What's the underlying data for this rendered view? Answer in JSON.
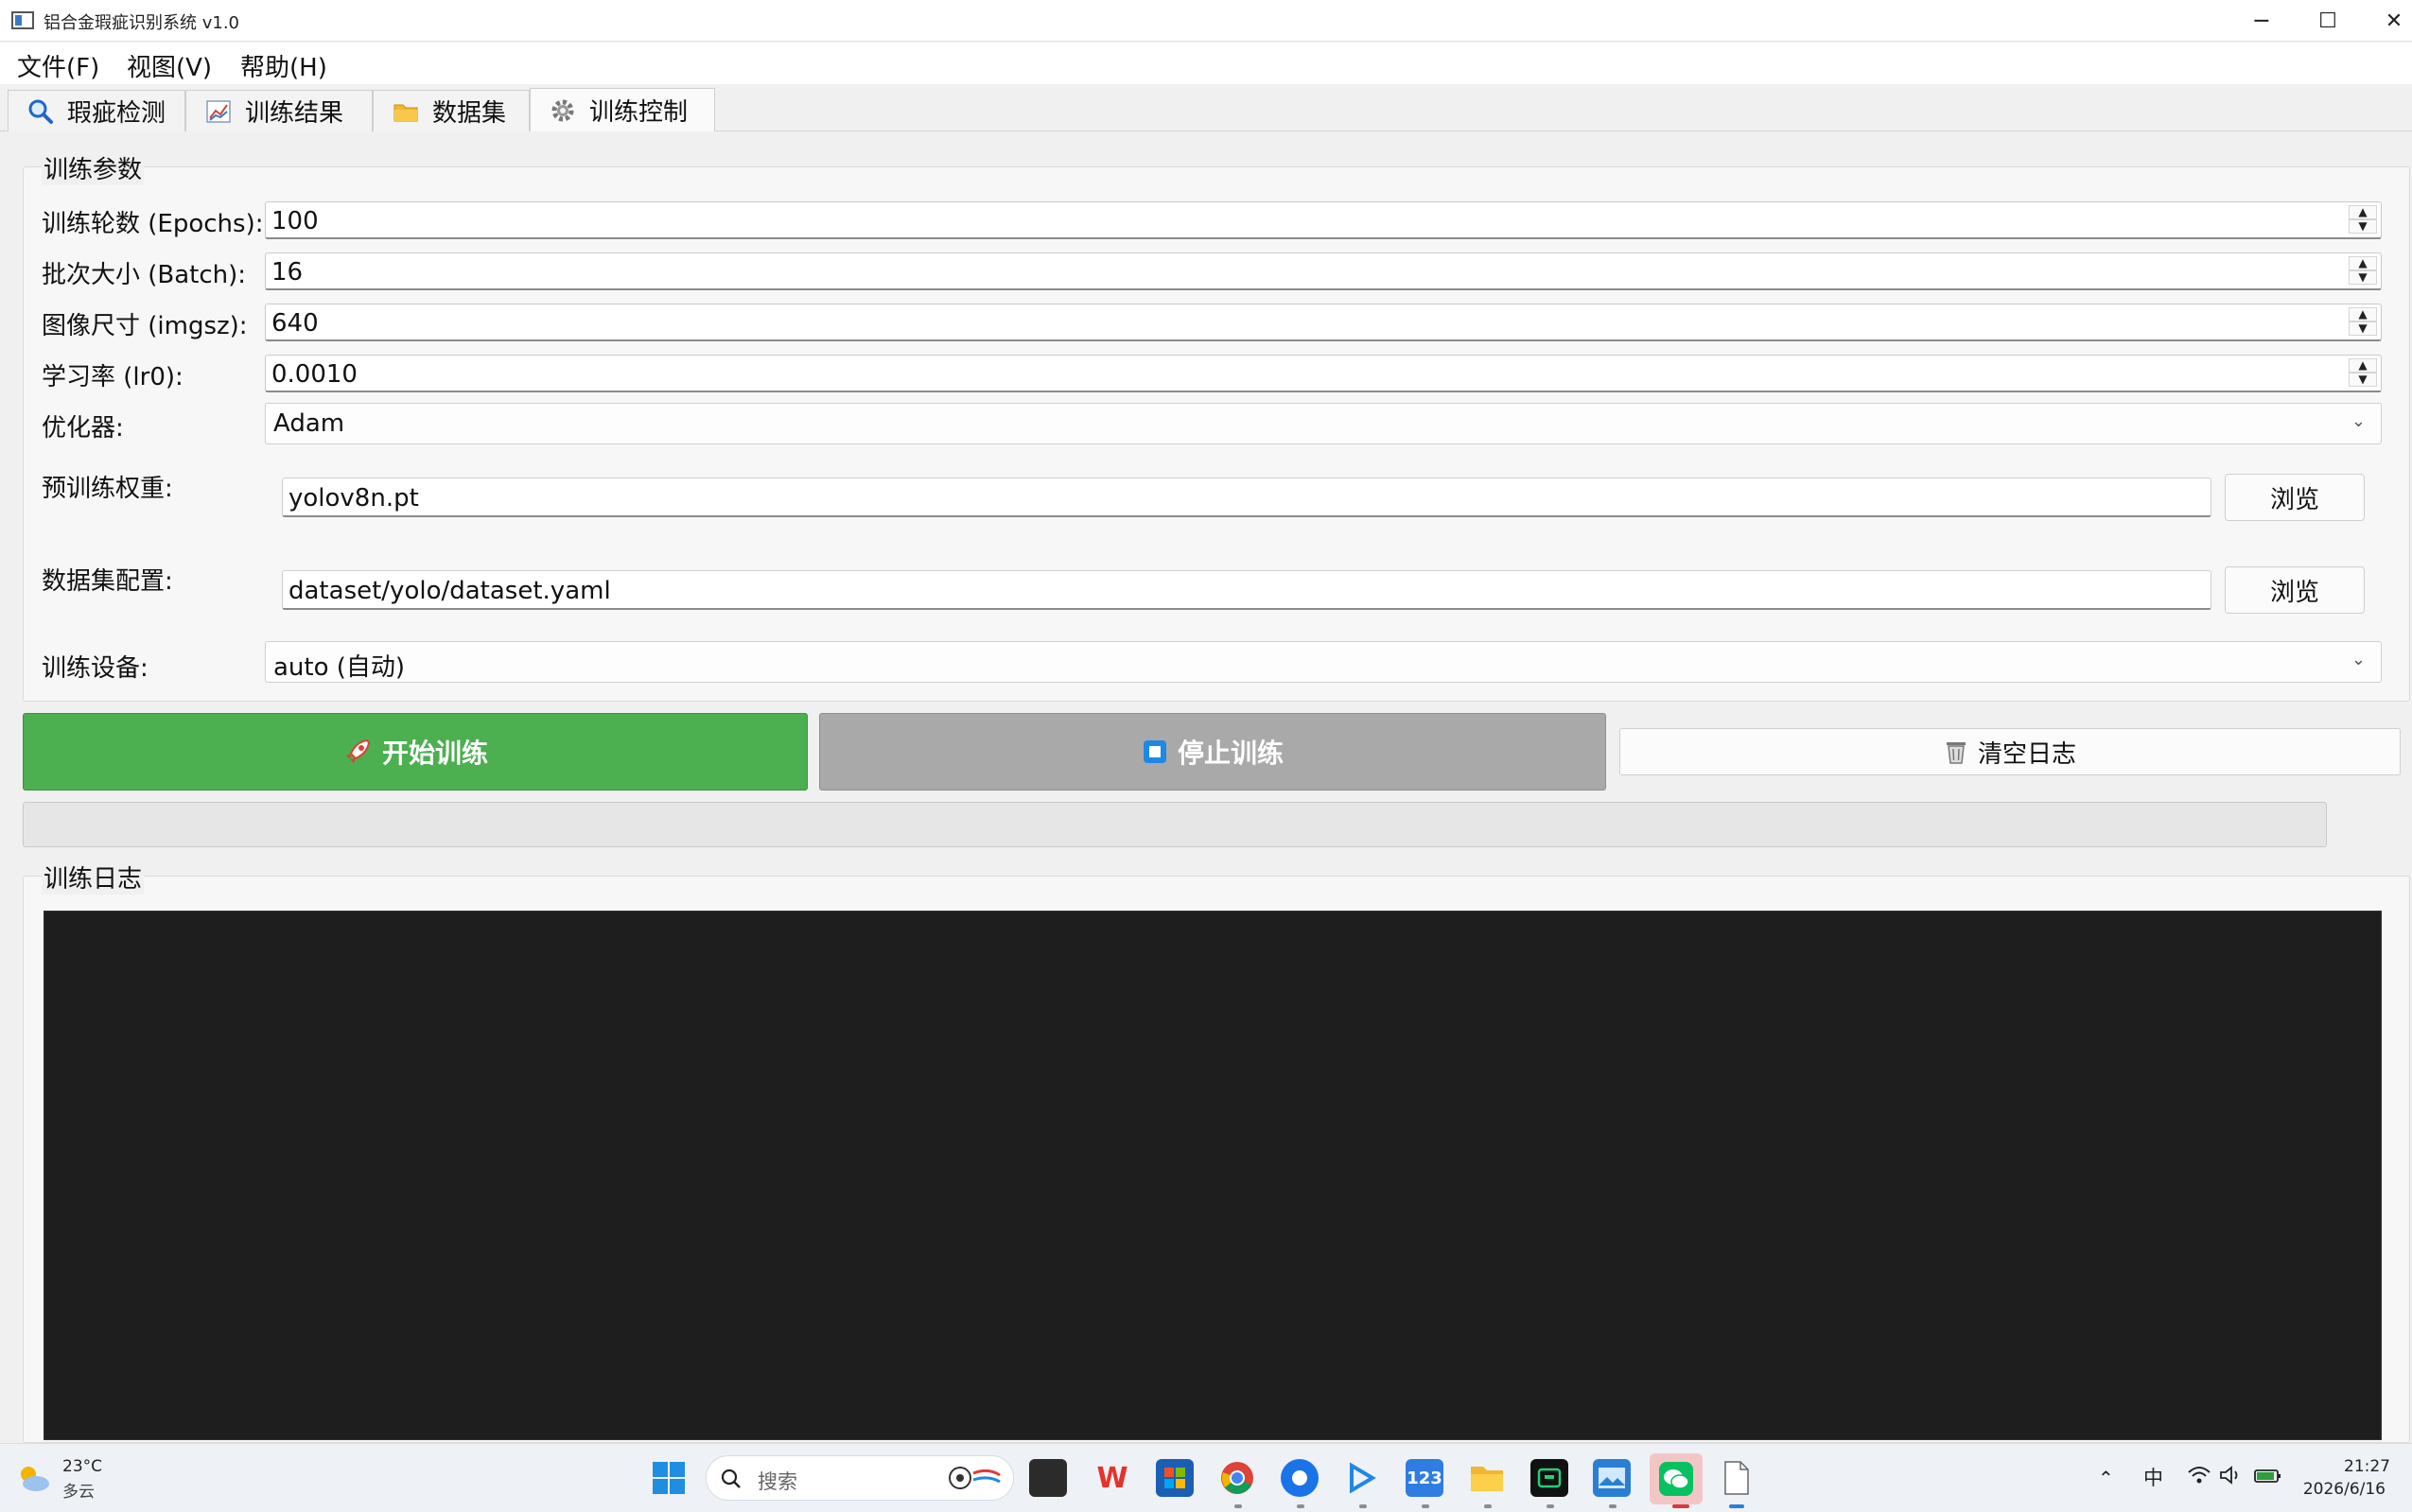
{
  "window": {
    "title": "铝合金瑕疵识别系统 v1.0",
    "minimize": "─",
    "maximize": "☐",
    "close": "✕"
  },
  "menu": {
    "items": [
      "文件(F)",
      "视图(V)",
      "帮助(H)"
    ]
  },
  "tabs": [
    {
      "label": "瑕疵检测",
      "icon": "search-icon"
    },
    {
      "label": "训练结果",
      "icon": "chart-icon"
    },
    {
      "label": "数据集",
      "icon": "folder-icon"
    },
    {
      "label": "训练控制",
      "icon": "gear-icon",
      "active": true
    }
  ],
  "params": {
    "group_title": "训练参数",
    "epochs": {
      "label": "训练轮数 (Epochs):",
      "value": "100"
    },
    "batch": {
      "label": "批次大小 (Batch):",
      "value": "16"
    },
    "imgsz": {
      "label": "图像尺寸 (imgsz):",
      "value": "640"
    },
    "lr0": {
      "label": "学习率 (lr0):",
      "value": "0.0010"
    },
    "optimizer": {
      "label": "优化器:",
      "value": "Adam"
    },
    "weights": {
      "label": "预训练权重:",
      "value": "yolov8n.pt",
      "browse": "浏览"
    },
    "dataset": {
      "label": "数据集配置:",
      "value": "dataset/yolo/dataset.yaml",
      "browse": "浏览"
    },
    "device": {
      "label": "训练设备:",
      "value": "auto (自动)"
    }
  },
  "actions": {
    "start": "开始训练",
    "stop": "停止训练",
    "clear": "清空日志",
    "start_color": "#4caf50",
    "stop_color": "#a9a9a9"
  },
  "progress": {
    "value": 0
  },
  "log": {
    "group_title": "训练日志",
    "background": "#1e1e1e"
  },
  "taskbar": {
    "weather_temp": "23°C",
    "weather_desc": "多云",
    "search_placeholder": "搜索",
    "ime": "中",
    "time": "21:27",
    "date": "2026/6/16"
  }
}
